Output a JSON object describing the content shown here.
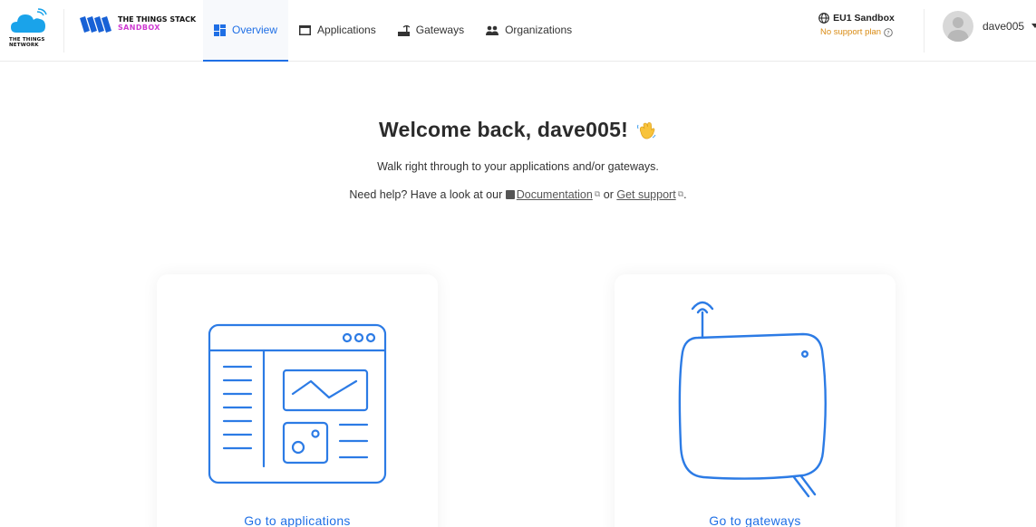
{
  "header": {
    "ttn_logo_text_line1": "THE THINGS",
    "ttn_logo_text_line2": "NETWORK",
    "tts_title": "THE THINGS STACK",
    "tts_subtitle": "SANDBOX",
    "nav": [
      {
        "label": "Overview",
        "icon": "dashboard-icon",
        "active": true
      },
      {
        "label": "Applications",
        "icon": "window-icon",
        "active": false
      },
      {
        "label": "Gateways",
        "icon": "router-icon",
        "active": false
      },
      {
        "label": "Organizations",
        "icon": "people-icon",
        "active": false
      }
    ],
    "cluster": {
      "name": "EU1 Sandbox",
      "support": "No support plan"
    },
    "user": {
      "name": "dave005"
    }
  },
  "welcome": {
    "title": "Welcome back, dave005!",
    "subtitle": "Walk right through to your applications and/or gateways.",
    "help_prefix": "Need help? Have a look at our",
    "documentation_link": "Documentation",
    "or_text": "or",
    "support_link": "Get support",
    "suffix": "."
  },
  "cards": {
    "applications": {
      "label": "Go to applications"
    },
    "gateways": {
      "label": "Go to gateways"
    }
  },
  "colors": {
    "accent": "#1f6fe5",
    "illustration": "#2c7be5",
    "support_warning": "#d98b14",
    "sandbox": "#cf3ad2"
  }
}
